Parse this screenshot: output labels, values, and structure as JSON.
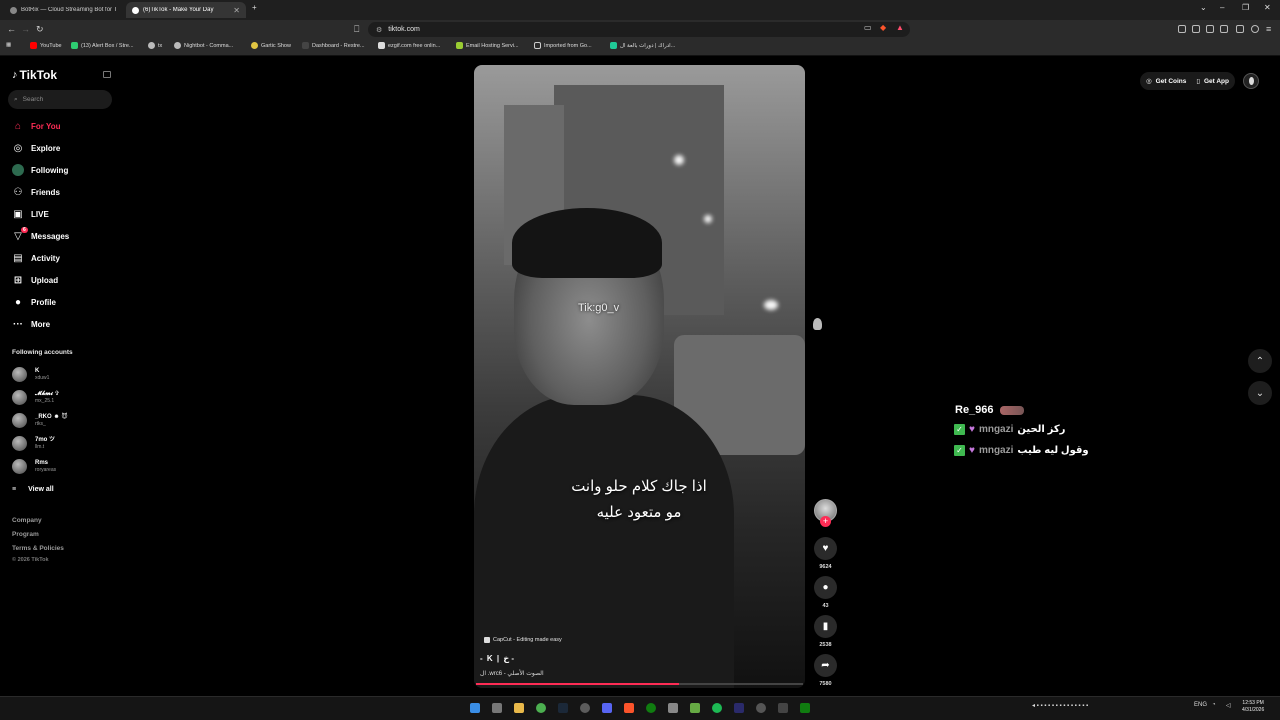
{
  "browser": {
    "tabs": [
      {
        "title": "BotRix — Cloud Streaming Bot for Tw",
        "active": false
      },
      {
        "title": "(6)TikTok - Make Your Day",
        "active": true
      }
    ],
    "url": "tiktok.com",
    "bookmarks": [
      {
        "label": "YouTube",
        "color": "#ff0000"
      },
      {
        "label": "(13) Alert Box / Stre...",
        "color": "#2ecc71"
      },
      {
        "label": "tx",
        "color": "#bbbbbb"
      },
      {
        "label": "Nightbot - Comma...",
        "color": "#bbbbbb"
      },
      {
        "label": "Gartic Show",
        "color": "#e1c542"
      },
      {
        "label": "Dashboard - Restre...",
        "color": "#444444"
      },
      {
        "label": "ezgif.com free onlin...",
        "color": "#dddddd"
      },
      {
        "label": "Email Hosting Servi...",
        "color": "#9acd32"
      },
      {
        "label": "Imported from Go...",
        "color": "#cccccc"
      },
      {
        "label": "ادراك | دورات بالعة ال...",
        "color": "#20c997"
      }
    ]
  },
  "sidebar": {
    "brand": "TikTok",
    "search_placeholder": "Search",
    "nav": [
      {
        "label": "For You",
        "icon": "home-icon",
        "active": true
      },
      {
        "label": "Explore",
        "icon": "compass-icon",
        "active": false
      },
      {
        "label": "Following",
        "icon": "following-icon",
        "active": false
      },
      {
        "label": "Friends",
        "icon": "friends-icon",
        "active": false
      },
      {
        "label": "LIVE",
        "icon": "live-icon",
        "active": false
      },
      {
        "label": "Messages",
        "icon": "messages-icon",
        "active": false,
        "badge": "6"
      },
      {
        "label": "Activity",
        "icon": "activity-icon",
        "active": false
      },
      {
        "label": "Upload",
        "icon": "upload-icon",
        "active": false
      },
      {
        "label": "Profile",
        "icon": "profile-icon",
        "active": false
      },
      {
        "label": "More",
        "icon": "more-icon",
        "active": false
      }
    ],
    "following_title": "Following accounts",
    "accounts": [
      {
        "name": "K",
        "handle": "xduw1"
      },
      {
        "name": "𝓜𝓴𝓶𝓲 ✞",
        "handle": "mx_25.1"
      },
      {
        "name": "_RKO ☻ 😈",
        "handle": "rtks_"
      },
      {
        "name": "7mo ツ",
        "handle": "llm.t"
      },
      {
        "name": "Rms",
        "handle": "roryareas"
      }
    ],
    "view_all": "View all",
    "footer": [
      "Company",
      "Program",
      "Terms & Policies"
    ],
    "copyright": "© 2026 TikTok"
  },
  "video": {
    "watermark": "Tik:g0_v",
    "caption_line1": "اذا جاك كلام حلو وانت",
    "caption_line2": "مو متعود عليه",
    "capcut": "CapCut - Editing made easy",
    "author": "- K | خ -",
    "sound": "الصوت الأصلي - wrc6. ال",
    "progress": 0.62
  },
  "actions": {
    "likes": "9624",
    "comments": "43",
    "saves": "2538",
    "shares": "7580"
  },
  "topbar": {
    "get_coins": "Get Coins",
    "get_app": "Get App"
  },
  "chat": {
    "user": "Re_966",
    "messages": [
      {
        "name": "mngazi",
        "text": "ركز الحين"
      },
      {
        "name": "mngazi",
        "text": "وقول ليه طيب"
      }
    ]
  },
  "taskbar": {
    "lang": "ENG",
    "time": "12:53 PM",
    "date": "4/31/2026"
  }
}
